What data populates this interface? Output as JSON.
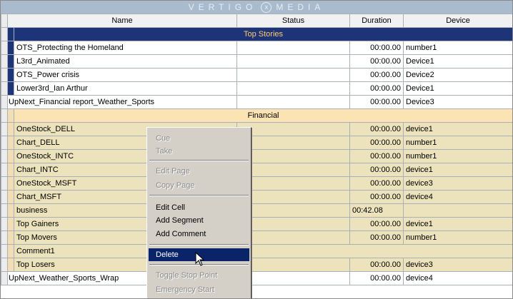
{
  "app": {
    "logo_left": "VERTIGO",
    "logo_mark": "x",
    "logo_right": "MEDIA"
  },
  "columns": {
    "name": "Name",
    "status": "Status",
    "duration": "Duration",
    "device": "Device"
  },
  "groups": {
    "top_stories": "Top Stories",
    "financial": "Financial"
  },
  "rows": [
    {
      "name": "OTS_Protecting the Homeland",
      "status": "",
      "duration": "00:00.00",
      "device": "number1"
    },
    {
      "name": "L3rd_Animated",
      "status": "",
      "duration": "00:00.00",
      "device": "Device1"
    },
    {
      "name": "OTS_Power crisis",
      "status": "",
      "duration": "00:00.00",
      "device": "Device2"
    },
    {
      "name": "Lower3rd_Ian Arthur",
      "status": "",
      "duration": "00:00.00",
      "device": "Device1"
    },
    {
      "name": "UpNext_Financial report_Weather_Sports",
      "status": "",
      "duration": "00:00.00",
      "device": "Device3"
    },
    {
      "name": "OneStock_DELL",
      "status": "",
      "duration": "00:00.00",
      "device": "device1"
    },
    {
      "name": "Chart_DELL",
      "status": "",
      "duration": "00:00.00",
      "device": "number1"
    },
    {
      "name": "OneStock_INTC",
      "status": "",
      "duration": "00:00.00",
      "device": "number1"
    },
    {
      "name": "Chart_INTC",
      "status": "",
      "duration": "00:00.00",
      "device": "device1"
    },
    {
      "name": "OneStock_MSFT",
      "status": "",
      "duration": "00:00.00",
      "device": "device3"
    },
    {
      "name": "Chart_MSFT",
      "status": "",
      "duration": "00:00.00",
      "device": "device4"
    },
    {
      "name": "business",
      "status": "",
      "duration": "00:42.08",
      "device": ""
    },
    {
      "name": "Top Gainers",
      "status": "",
      "duration": "00:00.00",
      "device": "device1"
    },
    {
      "name": "Top Movers",
      "status": "",
      "duration": "00:00.00",
      "device": "number1"
    },
    {
      "name": "Comment1",
      "status": "",
      "duration": "",
      "device": ""
    },
    {
      "name": "Top Losers",
      "status": "",
      "duration": "00:00.00",
      "device": "device3"
    },
    {
      "name": "UpNext_Weather_Sports_Wrap",
      "status": "",
      "duration": "00:00.00",
      "device": "device4"
    }
  ],
  "context_menu": {
    "cue": "Cue",
    "take": "Take",
    "edit_page": "Edit Page",
    "copy_page": "Copy Page",
    "edit_cell": "Edit Cell",
    "add_segment": "Add Segment",
    "add_comment": "Add Comment",
    "delete": "Delete",
    "toggle_stop_point": "Toggle Stop Point",
    "emergency_start": "Emergency Start"
  },
  "colors": {
    "titlebar": "#a9bbcd",
    "top_stories_header": "#1e3478",
    "financial_header": "#fbe3b4",
    "financial_row": "#ece2bc",
    "menu_highlight": "#0a246a"
  }
}
